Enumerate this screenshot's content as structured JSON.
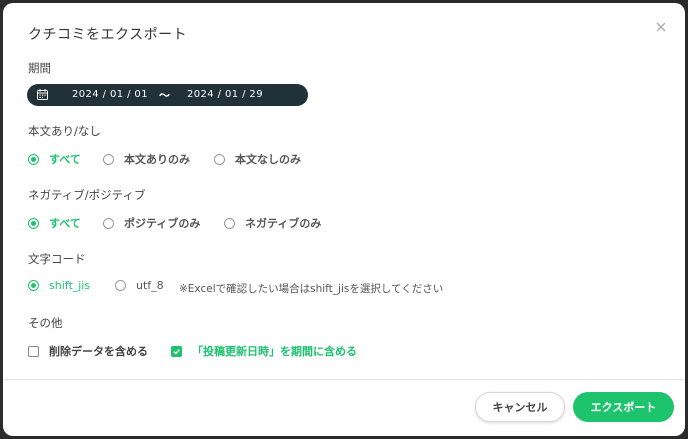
{
  "modal": {
    "title": "クチコミをエクスポート",
    "close_icon": "close-icon"
  },
  "period": {
    "label": "期間",
    "start": "2024 / 01 / 01",
    "separator": "〜",
    "end": "2024 / 01 / 29",
    "icon": "calendar-icon"
  },
  "body_text": {
    "label": "本文あり/なし",
    "options": [
      "すべて",
      "本文ありのみ",
      "本文なしのみ"
    ],
    "selected": "すべて"
  },
  "sentiment": {
    "label": "ネガティブ/ポジティブ",
    "options": [
      "すべて",
      "ポジティブのみ",
      "ネガティブのみ"
    ],
    "selected": "すべて"
  },
  "encoding": {
    "label": "文字コード",
    "options": [
      "shift_jis",
      "utf_8"
    ],
    "selected": "shift_jis",
    "note": "※Excelで確認したい場合はshift_jisを選択してください"
  },
  "other": {
    "label": "その他",
    "include_deleted": {
      "label": "削除データを含める",
      "checked": false
    },
    "include_post_update": {
      "label": "「投稿更新日時」を期間に含める",
      "checked": true
    }
  },
  "footer": {
    "cancel_label": "キャンセル",
    "export_label": "エクスポート"
  },
  "colors": {
    "accent": "#1ec36d",
    "date_pill": "#203238"
  }
}
